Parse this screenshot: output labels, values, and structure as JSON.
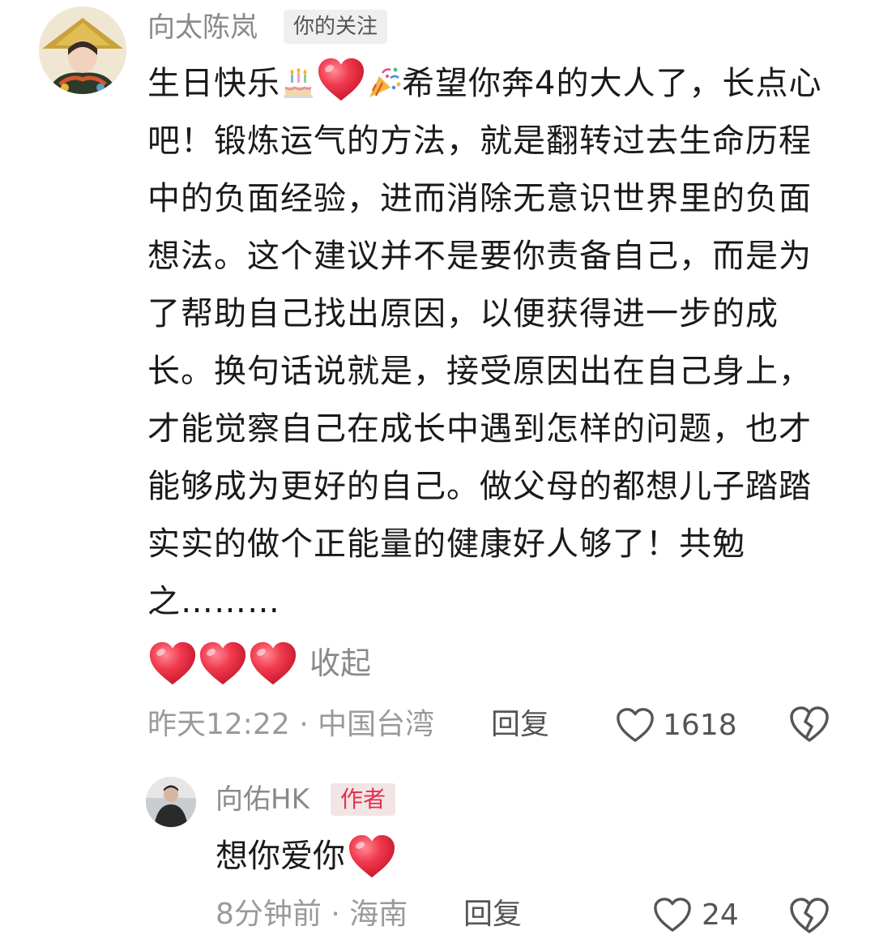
{
  "comment": {
    "author": "向太陈岚",
    "follow_tag": "你的关注",
    "text_part1": "生日快乐",
    "text_part2": "希望你奔4的大人了，长点心吧！锻炼运气的方法，就是翻转过去生命历程中的负面经验，进而消除无意识世界里的负面想法。这个建议并不是要你责备自己，而是为了帮助自己找出原因，以便获得进一步的成长。换句话说就是，接受原因出在自己身上，才能觉察自己在成长中遇到怎样的问题，也才能够成为更好的自己。做父母的都想儿子踏踏实实的做个正能量的健康好人够了！共勉之………",
    "emoji_1": "birthday-cake-icon",
    "emoji_2": "red-heart-icon",
    "emoji_3": "party-popper-icon",
    "collapse_label": "收起",
    "time": "昨天12:22",
    "location": "中国台湾",
    "reply_label": "回复",
    "like_count": "1618"
  },
  "reply": {
    "author": "向佑HK",
    "author_tag": "作者",
    "text": "想你爱你",
    "time": "8分钟前",
    "location": "海南",
    "reply_label": "回复",
    "like_count": "24"
  },
  "colors": {
    "heart_red": "#e8283c",
    "author_tag_text": "#e3304a",
    "author_tag_bg": "#f3e4e6",
    "meta_gray": "#9a9a9a"
  }
}
